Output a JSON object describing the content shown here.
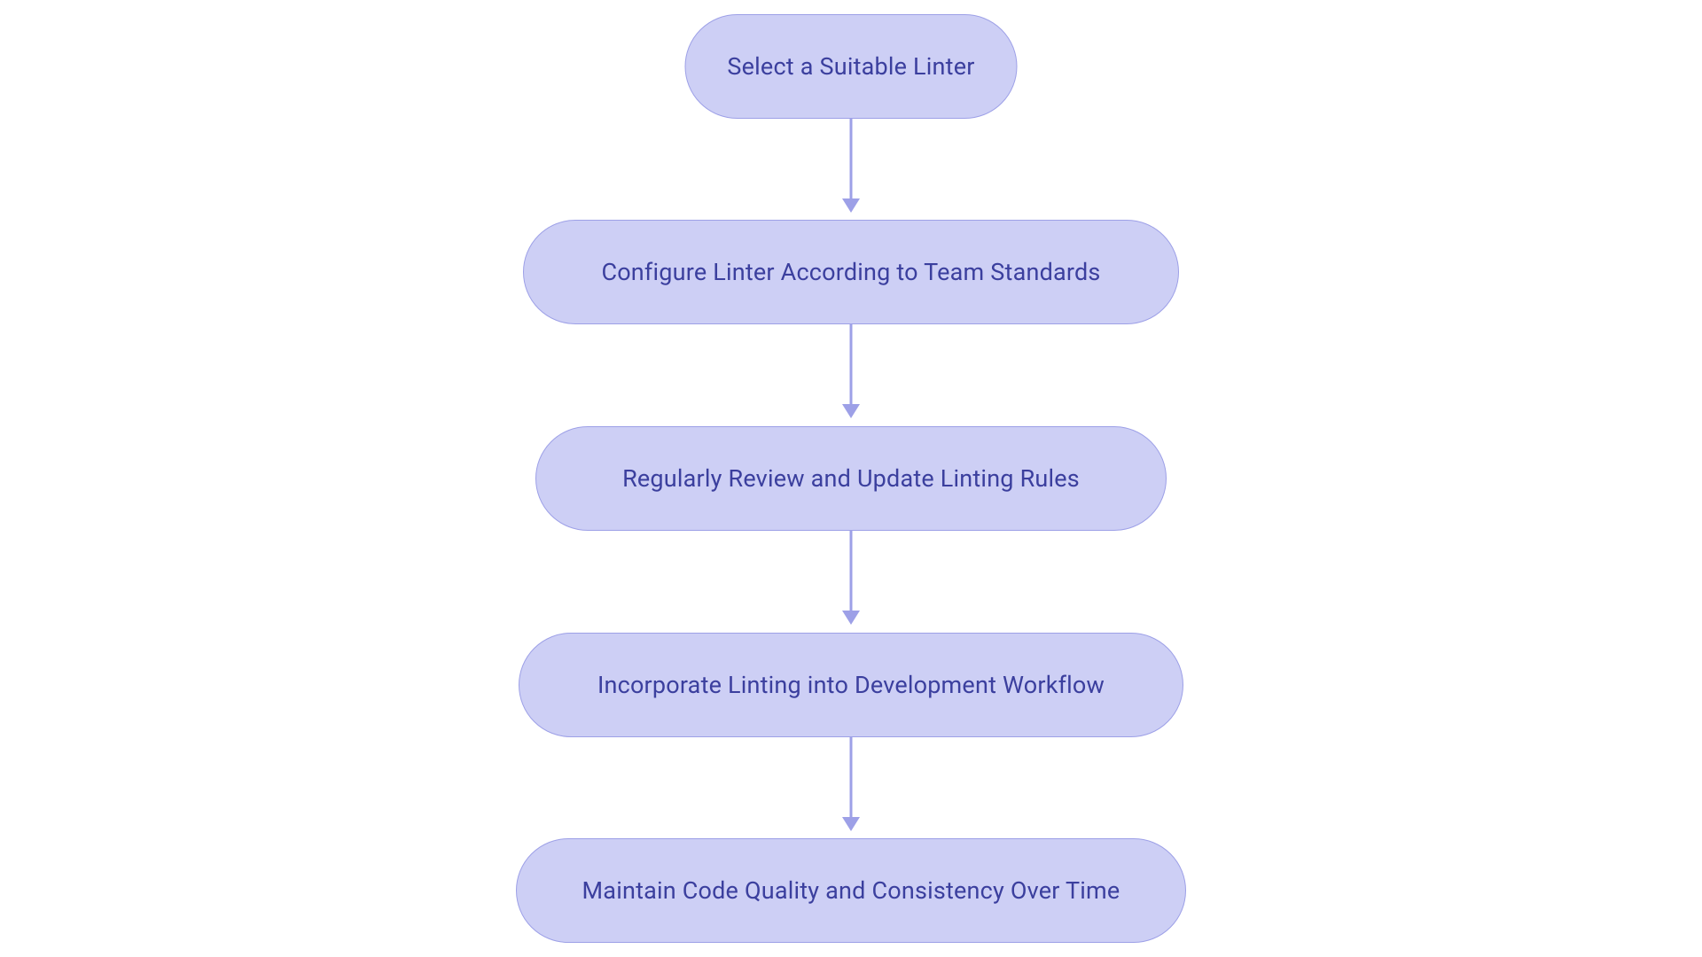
{
  "flow": {
    "nodes": [
      {
        "label": "Select a Suitable Linter"
      },
      {
        "label": "Configure Linter According to Team Standards"
      },
      {
        "label": "Regularly Review and Update Linting Rules"
      },
      {
        "label": "Incorporate Linting into Development Workflow"
      },
      {
        "label": "Maintain Code Quality and Consistency Over Time"
      }
    ]
  },
  "colors": {
    "node_bg": "#cdcff5",
    "node_border": "#9da0e7",
    "node_text": "#3b3f9e",
    "arrow": "#9da0e7"
  }
}
